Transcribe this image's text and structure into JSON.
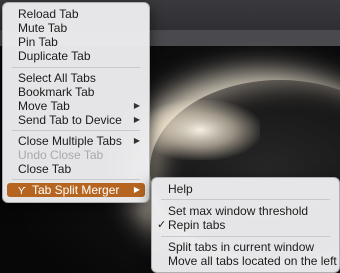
{
  "menu": {
    "items": [
      {
        "label": "Reload Tab"
      },
      {
        "label": "Mute Tab"
      },
      {
        "label": "Pin Tab"
      },
      {
        "label": "Duplicate Tab"
      },
      {
        "label": "Select All Tabs"
      },
      {
        "label": "Bookmark Tab"
      },
      {
        "label": "Move Tab"
      },
      {
        "label": "Send Tab to Device"
      },
      {
        "label": "Close Multiple Tabs"
      },
      {
        "label": "Undo Close Tab"
      },
      {
        "label": "Close Tab"
      },
      {
        "label": "Tab Split Merger",
        "icon": "ϒ"
      }
    ],
    "arrow": "▶"
  },
  "submenu": {
    "items": [
      {
        "label": "Help"
      },
      {
        "label": "Set max window threshold"
      },
      {
        "label": "Repin tabs",
        "check": "✓"
      },
      {
        "label": "Split tabs in current window"
      },
      {
        "label": "Move all tabs located on the left"
      }
    ]
  },
  "colors": {
    "highlight": "#b5651f"
  }
}
